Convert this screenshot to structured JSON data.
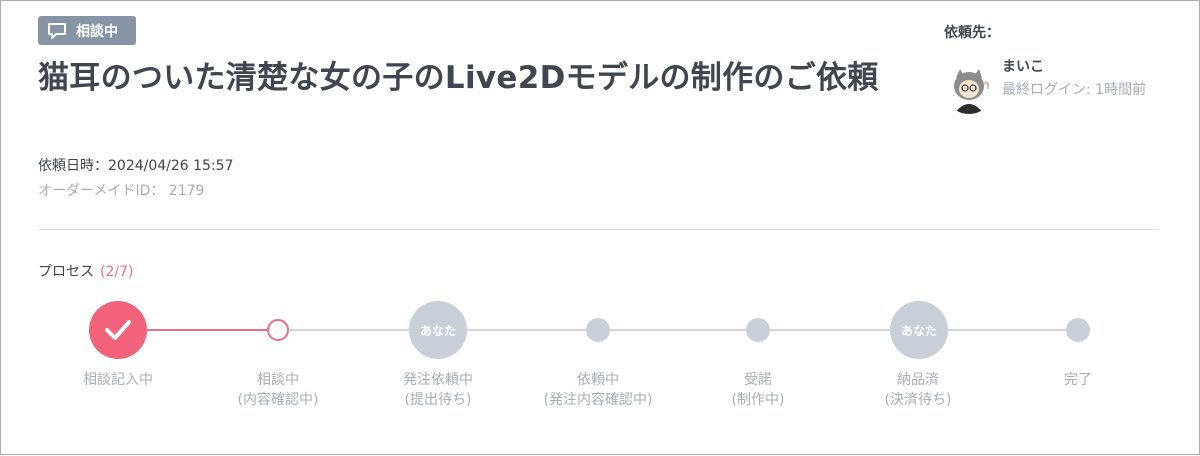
{
  "header": {
    "badge_label": "相談中",
    "title": "猫耳のついた清楚な女の子のLive2Dモデルの制作のご依頼",
    "request_datetime": "依頼日時：2024/04/26 15:57",
    "order_id": "オーダーメイドID：  2179"
  },
  "requester": {
    "label": "依頼先：",
    "name": "まいこ",
    "last_login": "最終ログイン: 1時間前"
  },
  "process": {
    "label": "プロセス",
    "count": "(2/7)",
    "you_marker": "あなた",
    "steps": [
      {
        "line1": "相談記入中",
        "line2": "",
        "state": "done"
      },
      {
        "line1": "相談中",
        "line2": "(内容確認中)",
        "state": "current"
      },
      {
        "line1": "発注依頼中",
        "line2": "(提出待ち)",
        "state": "you"
      },
      {
        "line1": "依頼中",
        "line2": "(発注内容確認中)",
        "state": "pending"
      },
      {
        "line1": "受諾",
        "line2": "(制作中)",
        "state": "pending"
      },
      {
        "line1": "納品済",
        "line2": "(決済待ち)",
        "state": "you"
      },
      {
        "line1": "完了",
        "line2": "",
        "state": "pending"
      }
    ]
  },
  "colors": {
    "accent": "#f2627a",
    "badge": "#8694a5",
    "inactive": "#c9cfd8"
  },
  "icons": {
    "badge": "chat-bubble-icon",
    "done": "check-icon",
    "avatar": "user-avatar"
  }
}
